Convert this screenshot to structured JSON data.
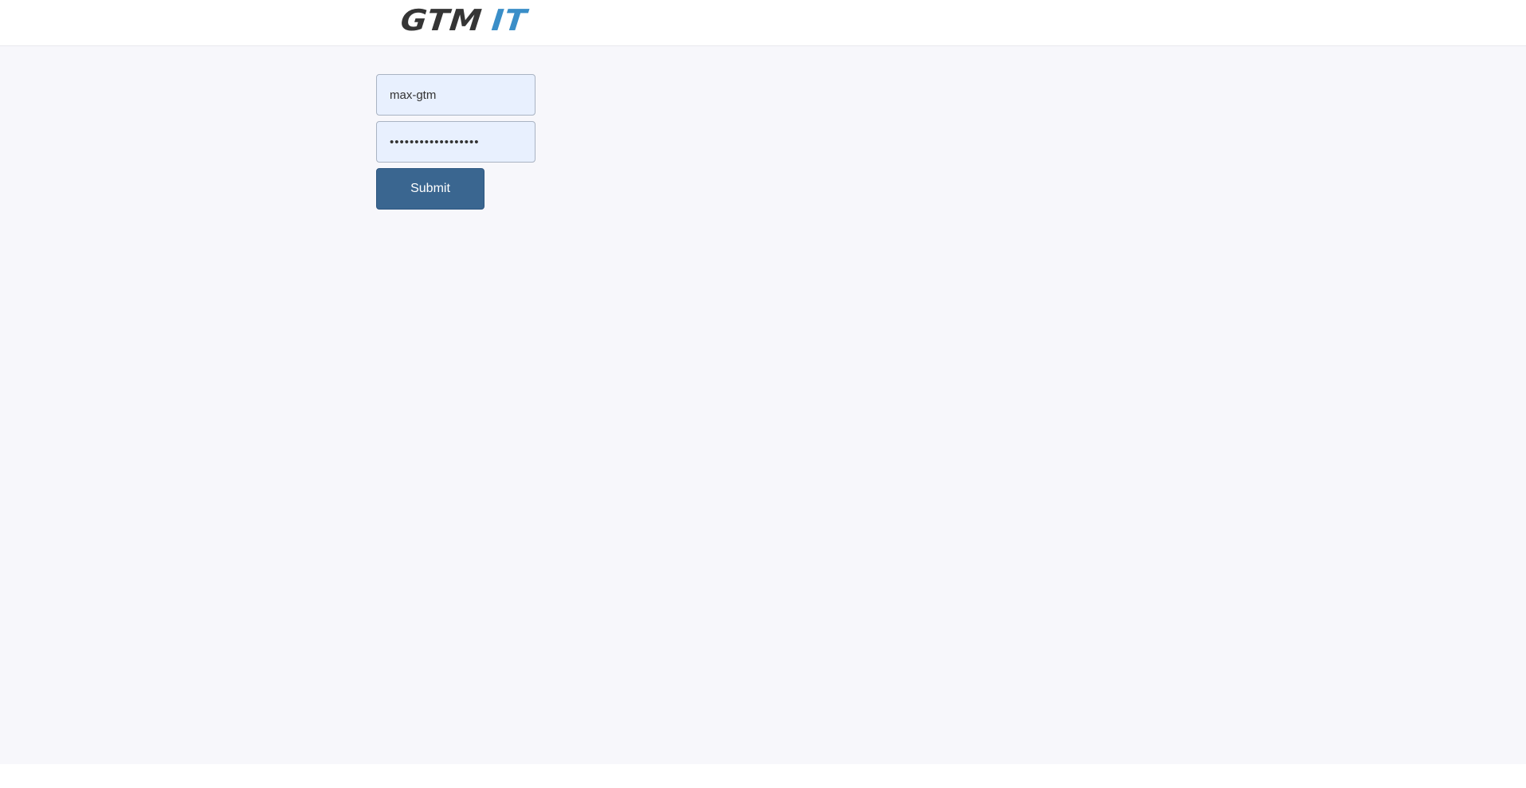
{
  "header": {
    "logo_part1": "GTM",
    "logo_part2": "IT"
  },
  "login_form": {
    "username_value": "max-gtm",
    "password_value": "••••••••••••••••••",
    "submit_label": "Submit"
  },
  "colors": {
    "logo_dark": "#353535",
    "logo_accent": "#3a8ec8",
    "input_background": "#e8f0fe",
    "button_background": "#3a6690",
    "page_background": "#f7f7fb"
  }
}
